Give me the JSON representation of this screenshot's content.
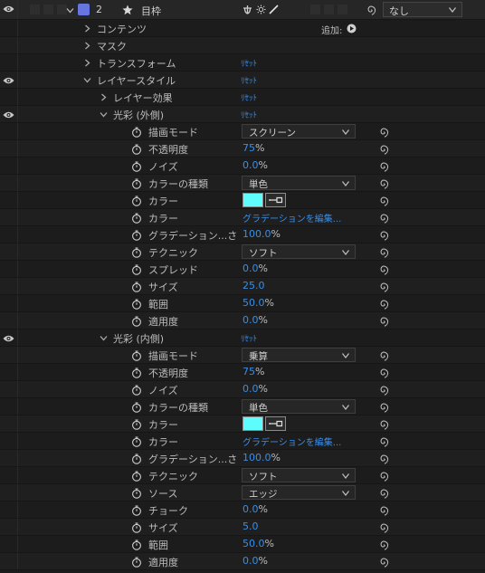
{
  "header": {
    "layer_number": "2",
    "layer_name": "目枠",
    "switch_icons": [
      "anchor-icon",
      "sun-icon",
      "slash-icon"
    ],
    "parent_value": "なし",
    "label_color": "#6675e0"
  },
  "rows": [
    {
      "kind": "group",
      "depth": 1,
      "twirl": "closed",
      "label": "コンテンツ",
      "add_label": "追加:"
    },
    {
      "kind": "group",
      "depth": 1,
      "twirl": "closed",
      "label": "マスク"
    },
    {
      "kind": "group",
      "depth": 1,
      "twirl": "closed",
      "label": "トランスフォーム",
      "reset": "ﾘｾｯﾄ"
    },
    {
      "kind": "group",
      "depth": 1,
      "twirl": "open",
      "label": "レイヤースタイル",
      "reset": "ﾘｾｯﾄ",
      "eye": true
    },
    {
      "kind": "group",
      "depth": 2,
      "twirl": "closed",
      "label": "レイヤー効果",
      "reset": "ﾘｾｯﾄ"
    },
    {
      "kind": "group",
      "depth": 2,
      "twirl": "open",
      "label": "光彩 (外側)",
      "reset": "ﾘｾｯﾄ",
      "eye": true
    },
    {
      "kind": "prop",
      "label": "描画モード",
      "type": "dropdown",
      "value": "スクリーン"
    },
    {
      "kind": "prop",
      "label": "不透明度",
      "type": "number",
      "value": "75",
      "unit": "%"
    },
    {
      "kind": "prop",
      "label": "ノイズ",
      "type": "number",
      "value": "0.0",
      "unit": "%"
    },
    {
      "kind": "prop",
      "label": "カラーの種類",
      "type": "dropdown",
      "value": "単色"
    },
    {
      "kind": "prop",
      "label": "カラー",
      "type": "color",
      "color": "#5ffcfd"
    },
    {
      "kind": "prop",
      "label": "カラー",
      "type": "link",
      "value": "グラデーションを編集..."
    },
    {
      "kind": "prop",
      "label": "グラデーション...さ",
      "type": "number",
      "value": "100.0",
      "unit": "%"
    },
    {
      "kind": "prop",
      "label": "テクニック",
      "type": "dropdown",
      "value": "ソフト"
    },
    {
      "kind": "prop",
      "label": "スプレッド",
      "type": "number",
      "value": "0.0",
      "unit": "%"
    },
    {
      "kind": "prop",
      "label": "サイズ",
      "type": "number",
      "value": "25.0",
      "unit": ""
    },
    {
      "kind": "prop",
      "label": "範囲",
      "type": "number",
      "value": "50.0",
      "unit": "%"
    },
    {
      "kind": "prop",
      "label": "適用度",
      "type": "number",
      "value": "0.0",
      "unit": "%"
    },
    {
      "kind": "group",
      "depth": 2,
      "twirl": "open",
      "label": "光彩 (内側)",
      "reset": "ﾘｾｯﾄ",
      "eye": true
    },
    {
      "kind": "prop",
      "label": "描画モード",
      "type": "dropdown",
      "value": "乗算"
    },
    {
      "kind": "prop",
      "label": "不透明度",
      "type": "number",
      "value": "75",
      "unit": "%"
    },
    {
      "kind": "prop",
      "label": "ノイズ",
      "type": "number",
      "value": "0.0",
      "unit": "%"
    },
    {
      "kind": "prop",
      "label": "カラーの種類",
      "type": "dropdown",
      "value": "単色"
    },
    {
      "kind": "prop",
      "label": "カラー",
      "type": "color",
      "color": "#5ffcfd"
    },
    {
      "kind": "prop",
      "label": "カラー",
      "type": "link",
      "value": "グラデーションを編集..."
    },
    {
      "kind": "prop",
      "label": "グラデーション...さ",
      "type": "number",
      "value": "100.0",
      "unit": "%"
    },
    {
      "kind": "prop",
      "label": "テクニック",
      "type": "dropdown",
      "value": "ソフト"
    },
    {
      "kind": "prop",
      "label": "ソース",
      "type": "dropdown",
      "value": "エッジ"
    },
    {
      "kind": "prop",
      "label": "チョーク",
      "type": "number",
      "value": "0.0",
      "unit": "%"
    },
    {
      "kind": "prop",
      "label": "サイズ",
      "type": "number",
      "value": "5.0",
      "unit": ""
    },
    {
      "kind": "prop",
      "label": "範囲",
      "type": "number",
      "value": "50.0",
      "unit": "%"
    },
    {
      "kind": "prop",
      "label": "適用度",
      "type": "number",
      "value": "0.0",
      "unit": "%"
    }
  ]
}
